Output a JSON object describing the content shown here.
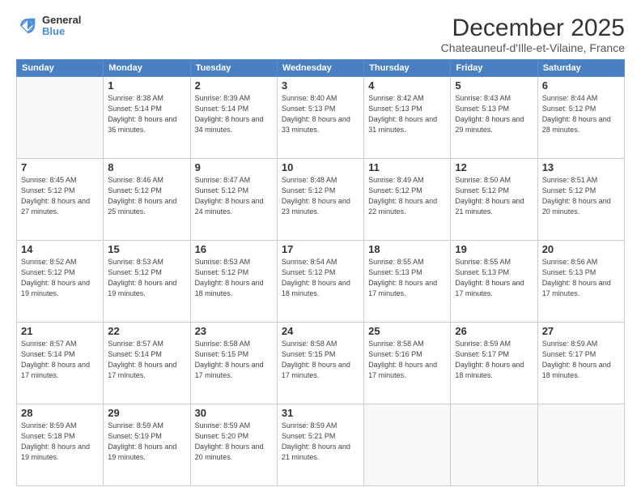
{
  "logo": {
    "general": "General",
    "blue": "Blue"
  },
  "header": {
    "month": "December 2025",
    "location": "Chateauneuf-d'Ille-et-Vilaine, France"
  },
  "weekdays": [
    "Sunday",
    "Monday",
    "Tuesday",
    "Wednesday",
    "Thursday",
    "Friday",
    "Saturday"
  ],
  "weeks": [
    [
      {
        "day": null
      },
      {
        "day": 1,
        "sunrise": "8:38 AM",
        "sunset": "5:14 PM",
        "daylight": "8 hours and 36 minutes."
      },
      {
        "day": 2,
        "sunrise": "8:39 AM",
        "sunset": "5:14 PM",
        "daylight": "8 hours and 34 minutes."
      },
      {
        "day": 3,
        "sunrise": "8:40 AM",
        "sunset": "5:13 PM",
        "daylight": "8 hours and 33 minutes."
      },
      {
        "day": 4,
        "sunrise": "8:42 AM",
        "sunset": "5:13 PM",
        "daylight": "8 hours and 31 minutes."
      },
      {
        "day": 5,
        "sunrise": "8:43 AM",
        "sunset": "5:13 PM",
        "daylight": "8 hours and 29 minutes."
      },
      {
        "day": 6,
        "sunrise": "8:44 AM",
        "sunset": "5:12 PM",
        "daylight": "8 hours and 28 minutes."
      }
    ],
    [
      {
        "day": 7,
        "sunrise": "8:45 AM",
        "sunset": "5:12 PM",
        "daylight": "8 hours and 27 minutes."
      },
      {
        "day": 8,
        "sunrise": "8:46 AM",
        "sunset": "5:12 PM",
        "daylight": "8 hours and 25 minutes."
      },
      {
        "day": 9,
        "sunrise": "8:47 AM",
        "sunset": "5:12 PM",
        "daylight": "8 hours and 24 minutes."
      },
      {
        "day": 10,
        "sunrise": "8:48 AM",
        "sunset": "5:12 PM",
        "daylight": "8 hours and 23 minutes."
      },
      {
        "day": 11,
        "sunrise": "8:49 AM",
        "sunset": "5:12 PM",
        "daylight": "8 hours and 22 minutes."
      },
      {
        "day": 12,
        "sunrise": "8:50 AM",
        "sunset": "5:12 PM",
        "daylight": "8 hours and 21 minutes."
      },
      {
        "day": 13,
        "sunrise": "8:51 AM",
        "sunset": "5:12 PM",
        "daylight": "8 hours and 20 minutes."
      }
    ],
    [
      {
        "day": 14,
        "sunrise": "8:52 AM",
        "sunset": "5:12 PM",
        "daylight": "8 hours and 19 minutes."
      },
      {
        "day": 15,
        "sunrise": "8:53 AM",
        "sunset": "5:12 PM",
        "daylight": "8 hours and 19 minutes."
      },
      {
        "day": 16,
        "sunrise": "8:53 AM",
        "sunset": "5:12 PM",
        "daylight": "8 hours and 18 minutes."
      },
      {
        "day": 17,
        "sunrise": "8:54 AM",
        "sunset": "5:12 PM",
        "daylight": "8 hours and 18 minutes."
      },
      {
        "day": 18,
        "sunrise": "8:55 AM",
        "sunset": "5:13 PM",
        "daylight": "8 hours and 17 minutes."
      },
      {
        "day": 19,
        "sunrise": "8:55 AM",
        "sunset": "5:13 PM",
        "daylight": "8 hours and 17 minutes."
      },
      {
        "day": 20,
        "sunrise": "8:56 AM",
        "sunset": "5:13 PM",
        "daylight": "8 hours and 17 minutes."
      }
    ],
    [
      {
        "day": 21,
        "sunrise": "8:57 AM",
        "sunset": "5:14 PM",
        "daylight": "8 hours and 17 minutes."
      },
      {
        "day": 22,
        "sunrise": "8:57 AM",
        "sunset": "5:14 PM",
        "daylight": "8 hours and 17 minutes."
      },
      {
        "day": 23,
        "sunrise": "8:58 AM",
        "sunset": "5:15 PM",
        "daylight": "8 hours and 17 minutes."
      },
      {
        "day": 24,
        "sunrise": "8:58 AM",
        "sunset": "5:15 PM",
        "daylight": "8 hours and 17 minutes."
      },
      {
        "day": 25,
        "sunrise": "8:58 AM",
        "sunset": "5:16 PM",
        "daylight": "8 hours and 17 minutes."
      },
      {
        "day": 26,
        "sunrise": "8:59 AM",
        "sunset": "5:17 PM",
        "daylight": "8 hours and 18 minutes."
      },
      {
        "day": 27,
        "sunrise": "8:59 AM",
        "sunset": "5:17 PM",
        "daylight": "8 hours and 18 minutes."
      }
    ],
    [
      {
        "day": 28,
        "sunrise": "8:59 AM",
        "sunset": "5:18 PM",
        "daylight": "8 hours and 19 minutes."
      },
      {
        "day": 29,
        "sunrise": "8:59 AM",
        "sunset": "5:19 PM",
        "daylight": "8 hours and 19 minutes."
      },
      {
        "day": 30,
        "sunrise": "8:59 AM",
        "sunset": "5:20 PM",
        "daylight": "8 hours and 20 minutes."
      },
      {
        "day": 31,
        "sunrise": "8:59 AM",
        "sunset": "5:21 PM",
        "daylight": "8 hours and 21 minutes."
      },
      {
        "day": null
      },
      {
        "day": null
      },
      {
        "day": null
      }
    ]
  ]
}
